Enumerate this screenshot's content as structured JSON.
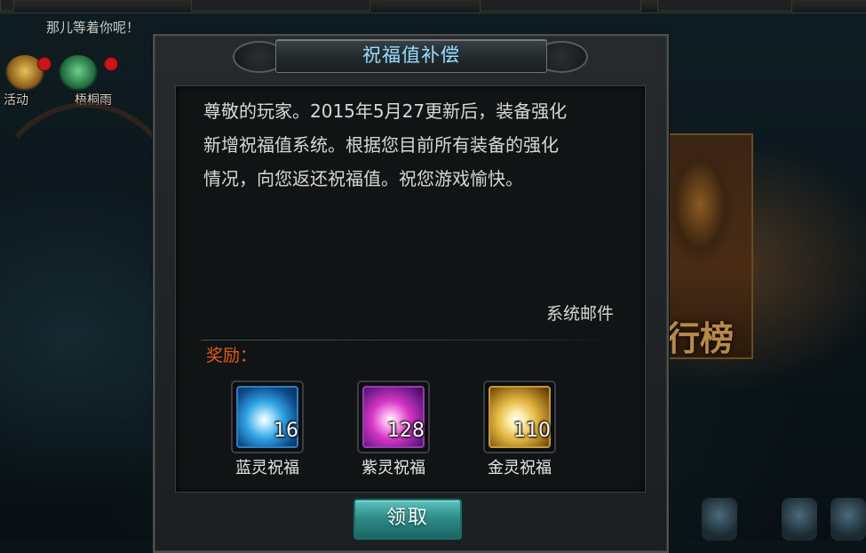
{
  "background": {
    "scroll_text": "那儿等着你呢！",
    "side_icons": [
      {
        "label": "活动",
        "icon": "activity-icon"
      },
      {
        "label": "梧桐雨",
        "icon": "wutong-rain-icon"
      }
    ],
    "rank_text": "行榜"
  },
  "dialog": {
    "title": "祝福值补偿",
    "message_lines": [
      "尊敬的玩家。2015年5月27更新后，装备强化",
      "新增祝福值系统。根据您目前所有装备的强化",
      "情况，向您返还祝福值。祝您游戏愉快。"
    ],
    "sender": "系统邮件",
    "reward_label": "奖励：",
    "rewards": [
      {
        "name": "蓝灵祝福",
        "count": "16",
        "icon": "blue-blessing-icon",
        "color": "#33a6e6"
      },
      {
        "name": "紫灵祝福",
        "count": "128",
        "icon": "purple-blessing-icon",
        "color": "#d636c6"
      },
      {
        "name": "金灵祝福",
        "count": "110",
        "icon": "gold-blessing-icon",
        "color": "#e2b640"
      }
    ],
    "claim_label": "领取"
  }
}
